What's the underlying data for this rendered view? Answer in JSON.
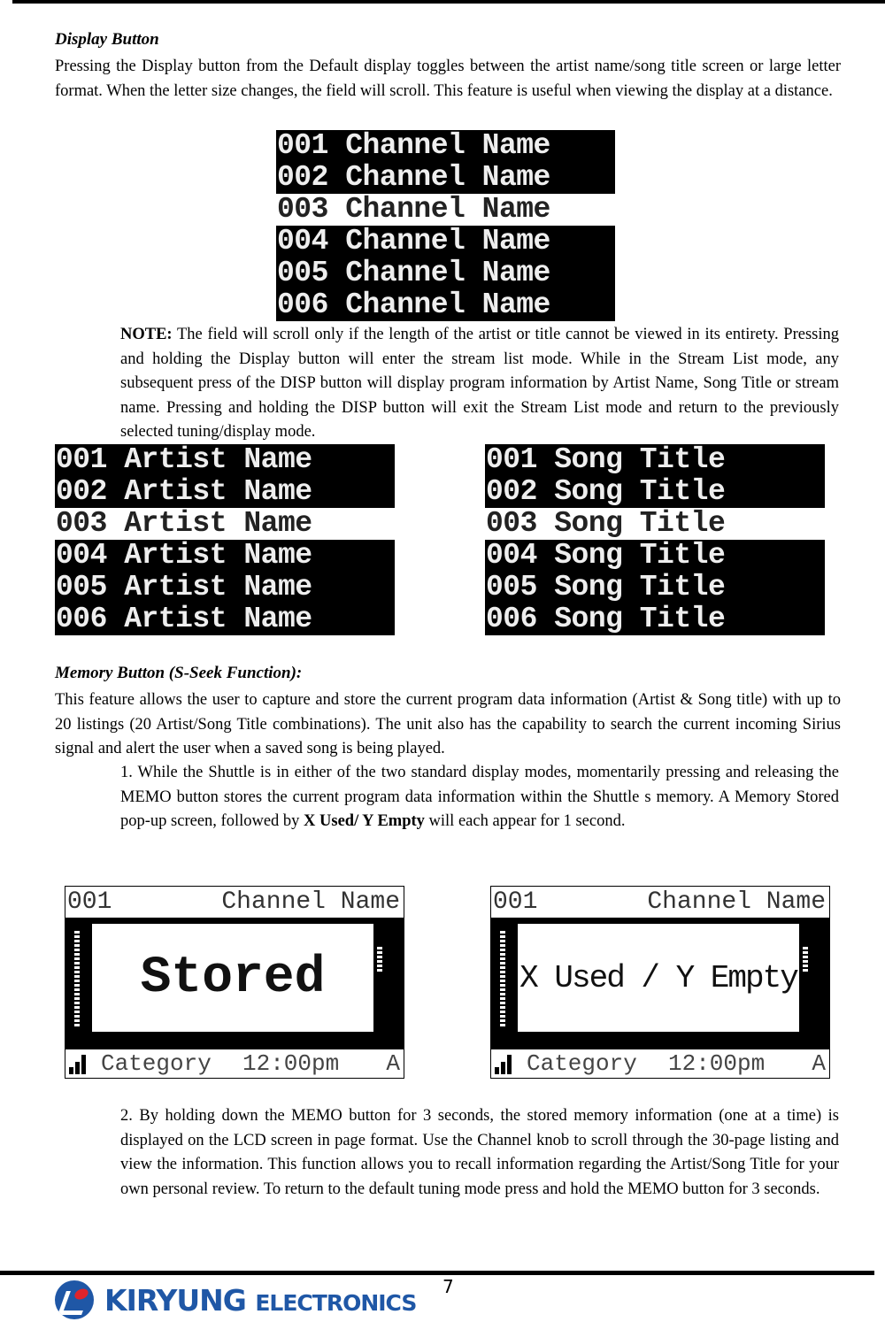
{
  "display_section": {
    "heading": "Display Button",
    "body": "Pressing the Display button from the Default display toggles between the artist name/song title screen or large letter format. When the letter size changes, the field will scroll. This feature is useful when viewing the display at a distance.",
    "channel_list": [
      "001 Channel Name",
      "002 Channel Name",
      "003 Channel Name",
      "004 Channel Name",
      "005 Channel Name",
      "006 Channel Name"
    ],
    "note_label": "NOTE:",
    "note_body": " The field will scroll only if the length of the artist or title cannot be viewed in its entirety. Pressing and holding the Display button will enter the stream list mode. While in the Stream List mode, any subsequent press of the DISP button will display program information by Artist Name, Song Title or stream name. Pressing and holding the DISP button will exit the Stream List mode and return to the previously selected tuning/display mode.",
    "artist_list": [
      "001 Artist Name",
      "002 Artist Name",
      "003 Artist Name",
      "004 Artist Name",
      "005 Artist Name",
      "006 Artist Name"
    ],
    "song_list": [
      "001 Song Title",
      "002 Song Title",
      "003 Song Title",
      "004 Song Title",
      "005 Song Title",
      "006 Song Title"
    ]
  },
  "memory_section": {
    "heading": "Memory Button (S-Seek Function):",
    "body": "This feature allows the user to capture and store the current program data information (Artist & Song title) with up to 20 listings (20 Artist/Song Title combinations). The unit also has the capability to search the current incoming Sirius signal and alert the user when a saved song is being played.",
    "step1_a": "1. While the Shuttle is in either of the two standard display modes, momentarily pressing and releasing the MEMO button stores the current program data information within the Shuttle   s memory. A Memory Stored pop-up screen, followed by ",
    "step1_bold": "X Used/ Y Empty",
    "step1_b": " will each appear for 1 second.",
    "screens": [
      {
        "channel_num": "001",
        "channel_name": "Channel Name",
        "popup": "Stored",
        "category": "Category",
        "time": "12:00pm",
        "band": "A"
      },
      {
        "channel_num": "001",
        "channel_name": "Channel Name",
        "popup": "X Used / Y Empty",
        "category": "Category",
        "time": "12:00pm",
        "band": "A"
      }
    ],
    "step2": "2. By holding down the MEMO button for 3 seconds, the stored memory information (one at a time) is displayed on the LCD screen in page format. Use the Channel knob to scroll through the 30-page listing and view the information. This function allows you to recall information regarding the Artist/Song Title for your own personal review. To return to the default tuning mode press and hold the MEMO button for 3 seconds."
  },
  "footer": {
    "page_number": "7",
    "logo_text": "KIRYUNG ELECTRONICS",
    "brand_color": "#1f57a6"
  }
}
